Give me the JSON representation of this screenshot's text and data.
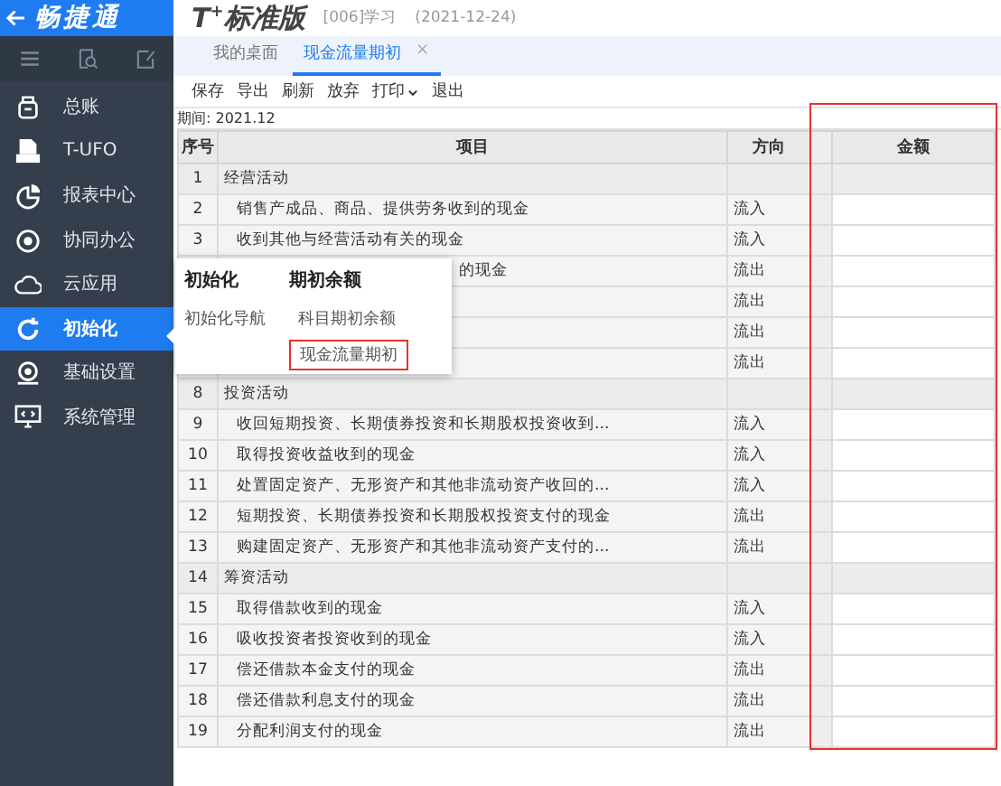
{
  "app": {
    "logo": "畅捷通"
  },
  "header": {
    "product": "T$^{+}$标准版",
    "account": "[006]学习",
    "date": "(2021-12-24)"
  },
  "sidebar": {
    "items": [
      {
        "label": "总账",
        "selected": false
      },
      {
        "label": "T-UFO",
        "selected": false
      },
      {
        "label": "报表中心",
        "selected": false
      },
      {
        "label": "协同办公",
        "selected": false
      },
      {
        "label": "云应用",
        "selected": false
      },
      {
        "label": "初始化",
        "selected": true
      },
      {
        "label": "基础设置",
        "selected": false
      },
      {
        "label": "系统管理",
        "selected": false
      }
    ]
  },
  "tabs": [
    {
      "label": "我的桌面",
      "selected": false
    },
    {
      "label": "现金流量期初",
      "selected": true,
      "close": "×"
    }
  ],
  "toolbar": [
    {
      "label": "保存",
      "dropdown": false
    },
    {
      "label": "导出",
      "dropdown": false
    },
    {
      "label": "刷新",
      "dropdown": false
    },
    {
      "label": "放弃",
      "dropdown": false
    },
    {
      "label": "打印",
      "dropdown": true
    },
    {
      "label": "退出",
      "dropdown": false
    }
  ],
  "period": "期间: 2021.12",
  "table": {
    "amount_column_highlighted": true,
    "columns": [
      {
        "kind": "text",
        "label": "序号"
      },
      {
        "kind": "text",
        "label": "项目"
      },
      {
        "kind": "text",
        "label": "方向"
      },
      {
        "kind": "blank"
      },
      {
        "kind": "text",
        "label": "金额"
      }
    ],
    "rows": [
      {
        "kind": "section",
        "no": "1",
        "item": "经营活动"
      },
      {
        "kind": "item",
        "no": "2",
        "item": "销售产成品、商品、提供劳务收到的现金",
        "direction": "流入"
      },
      {
        "kind": "item",
        "no": "3",
        "item": "收到其他与经营活动有关的现金",
        "direction": "流入"
      },
      {
        "kind": "covered",
        "item": "的现金",
        "direction": "流出"
      },
      {
        "kind": "covered",
        "direction": "流出"
      },
      {
        "kind": "covered",
        "direction": "流出"
      },
      {
        "kind": "covered",
        "direction": "流出"
      },
      {
        "kind": "section",
        "no": "8",
        "item": "投资活动"
      },
      {
        "kind": "item",
        "no": "9",
        "item": "收回短期投资、长期债券投资和长期股权投资收到...",
        "direction": "流入"
      },
      {
        "kind": "item",
        "no": "10",
        "item": "取得投资收益收到的现金",
        "direction": "流入"
      },
      {
        "kind": "item",
        "no": "11",
        "item": "处置固定资产、无形资产和其他非流动资产收回的...",
        "direction": "流入"
      },
      {
        "kind": "item",
        "no": "12",
        "item": "短期投资、长期债券投资和长期股权投资支付的现金",
        "direction": "流出"
      },
      {
        "kind": "item",
        "no": "13",
        "item": "购建固定资产、无形资产和其他非流动资产支付的...",
        "direction": "流出"
      },
      {
        "kind": "section",
        "no": "14",
        "item": "筹资活动"
      },
      {
        "kind": "item",
        "no": "15",
        "item": "取得借款收到的现金",
        "direction": "流入"
      },
      {
        "kind": "item",
        "no": "16",
        "item": "吸收投资者投资收到的现金",
        "direction": "流入"
      },
      {
        "kind": "item",
        "no": "17",
        "item": "偿还借款本金支付的现金",
        "direction": "流出"
      },
      {
        "kind": "item",
        "no": "18",
        "item": "偿还借款利息支付的现金",
        "direction": "流出"
      },
      {
        "kind": "item",
        "no": "19",
        "item": "分配利润支付的现金",
        "direction": "流出"
      }
    ]
  },
  "popup": {
    "groups": [
      {
        "title": "初始化",
        "links": [
          {
            "label": "初始化导航",
            "highlighted": false
          }
        ]
      },
      {
        "title": "期初余额",
        "links": [
          {
            "label": "科目期初余额",
            "highlighted": false
          },
          {
            "label": "现金流量期初",
            "highlighted": true
          }
        ]
      }
    ]
  }
}
